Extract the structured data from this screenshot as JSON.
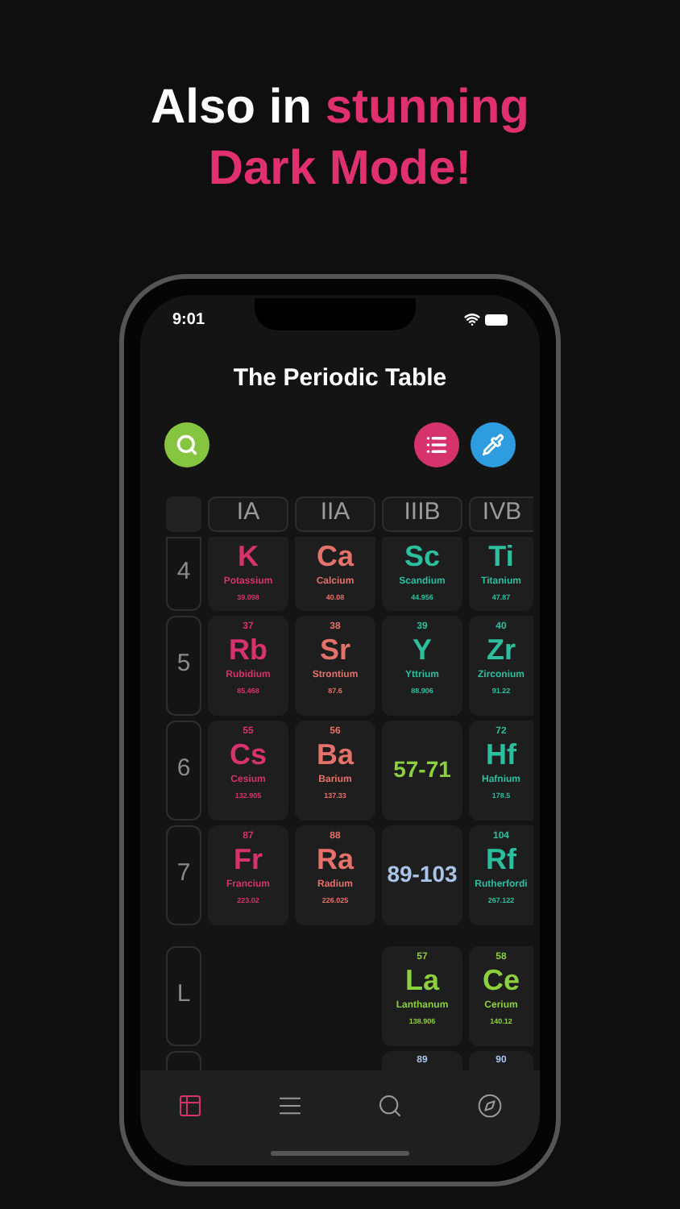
{
  "headline": {
    "plain": "Also in",
    "accent": "stunning Dark Mode!"
  },
  "status_bar": {
    "time": "9:01"
  },
  "title": "The Periodic Table",
  "buttons": [
    {
      "kind": "search",
      "color": "#86c540"
    },
    {
      "kind": "list",
      "color": "#d6336c"
    },
    {
      "kind": "picker",
      "color": "#2d9de0"
    }
  ],
  "group_headers": [
    "IA",
    "IIA",
    "IIIB",
    "IVB"
  ],
  "rows": [
    {
      "period": "4",
      "cut": true,
      "cells": [
        {
          "kind": "element",
          "symbol": "K",
          "name": "Potassium",
          "weight": "39.098",
          "color": "#d6336c"
        },
        {
          "kind": "element",
          "symbol": "Ca",
          "name": "Calcium",
          "weight": "40.08",
          "color": "#e5716b"
        },
        {
          "kind": "element",
          "symbol": "Sc",
          "name": "Scandium",
          "weight": "44.956",
          "color": "#2bbf9e"
        },
        {
          "kind": "element",
          "symbol": "Ti",
          "name": "Titanium",
          "weight": "47.87",
          "color": "#2bbf9e"
        }
      ]
    },
    {
      "period": "5",
      "cut": false,
      "cells": [
        {
          "kind": "element",
          "number": "37",
          "symbol": "Rb",
          "name": "Rubidium",
          "weight": "85.468",
          "color": "#d6336c"
        },
        {
          "kind": "element",
          "number": "38",
          "symbol": "Sr",
          "name": "Strontium",
          "weight": "87.6",
          "color": "#e5716b"
        },
        {
          "kind": "element",
          "number": "39",
          "symbol": "Y",
          "name": "Yttrium",
          "weight": "88.906",
          "color": "#2bbf9e"
        },
        {
          "kind": "element",
          "number": "40",
          "symbol": "Zr",
          "name": "Zirconium",
          "weight": "91.22",
          "color": "#2bbf9e"
        }
      ]
    },
    {
      "period": "6",
      "cut": false,
      "cells": [
        {
          "kind": "element",
          "number": "55",
          "symbol": "Cs",
          "name": "Cesium",
          "weight": "132.905",
          "color": "#d6336c"
        },
        {
          "kind": "element",
          "number": "56",
          "symbol": "Ba",
          "name": "Barium",
          "weight": "137.33",
          "color": "#e5716b"
        },
        {
          "kind": "range",
          "label": "57-71",
          "color": "#8ccf3f"
        },
        {
          "kind": "element",
          "number": "72",
          "symbol": "Hf",
          "name": "Hafnium",
          "weight": "178.5",
          "color": "#2bbf9e"
        }
      ]
    },
    {
      "period": "7",
      "cut": false,
      "cells": [
        {
          "kind": "element",
          "number": "87",
          "symbol": "Fr",
          "name": "Francium",
          "weight": "223.02",
          "color": "#d6336c"
        },
        {
          "kind": "element",
          "number": "88",
          "symbol": "Ra",
          "name": "Radium",
          "weight": "226.025",
          "color": "#e5716b"
        },
        {
          "kind": "range",
          "label": "89-103",
          "color": "#a9c4e8"
        },
        {
          "kind": "element",
          "number": "104",
          "symbol": "Rf",
          "name": "Rutherfordi",
          "weight": "267.122",
          "color": "#2bbf9e"
        }
      ]
    }
  ],
  "series_rows": [
    {
      "period": "L",
      "cells": [
        {
          "kind": "empty"
        },
        {
          "kind": "empty"
        },
        {
          "kind": "element",
          "number": "57",
          "symbol": "La",
          "name": "Lanthanum",
          "weight": "138.906",
          "color": "#8ccf3f"
        },
        {
          "kind": "element",
          "number": "58",
          "symbol": "Ce",
          "name": "Cerium",
          "weight": "140.12",
          "color": "#8ccf3f"
        }
      ]
    },
    {
      "cells": [
        {
          "kind": "empty"
        },
        {
          "kind": "empty"
        },
        {
          "kind": "element",
          "number": "89",
          "color": "#a9c4e8"
        },
        {
          "kind": "element",
          "number": "90",
          "color": "#a9c4e8"
        }
      ]
    }
  ],
  "tabs": [
    {
      "kind": "table",
      "selected": true
    },
    {
      "kind": "list",
      "selected": false
    },
    {
      "kind": "search",
      "selected": false
    },
    {
      "kind": "compass",
      "selected": false
    }
  ]
}
